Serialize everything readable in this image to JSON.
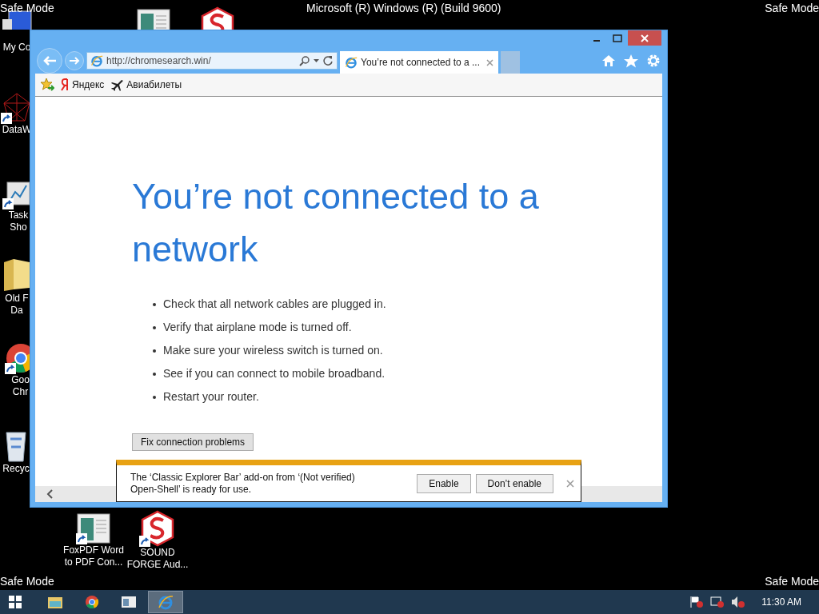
{
  "screen_labels": {
    "top_left": "Safe Mode",
    "top_center": "Microsoft (R) Windows (R) (Build 9600)",
    "top_right": "Safe Mode",
    "bottom_left": "Safe Mode",
    "bottom_right": "Safe Mode"
  },
  "desktop_icons": [
    {
      "kind": "computer",
      "lines": [
        "My Co"
      ]
    },
    {
      "kind": "web",
      "shortcut": true,
      "lines": [
        "DataW"
      ]
    },
    {
      "kind": "chart",
      "shortcut": true,
      "lines": [
        "Task",
        "Sho"
      ]
    },
    {
      "kind": "folder",
      "lines": [
        "Old F",
        "Da"
      ]
    },
    {
      "kind": "chrome",
      "shortcut": true,
      "lines": [
        "Goo",
        "Chr"
      ]
    },
    {
      "kind": "recycle",
      "lines": [
        "Recyc"
      ]
    },
    {
      "kind": "document"
    },
    {
      "kind": "sound"
    },
    {
      "kind": "document",
      "shortcut": true,
      "lines": [
        "FoxPDF Word",
        "to PDF Con..."
      ]
    },
    {
      "kind": "sound",
      "shortcut": true,
      "lines": [
        "SOUND",
        "FORGE Aud..."
      ]
    }
  ],
  "browser": {
    "address": "http://chromesearch.win/",
    "tabs": [
      {
        "title": "You’re not connected to a ...",
        "selected": true
      }
    ],
    "favorites": [
      {
        "kind": "yandex",
        "label": "Яндекс"
      },
      {
        "kind": "plane",
        "label": "Авиабилеты"
      }
    ],
    "page": {
      "heading": "You’re not connected to a network",
      "tips": [
        "Check that all network cables are plugged in.",
        "Verify that airplane mode is turned off.",
        "Make sure your wireless switch is turned on.",
        "See if you can connect to mobile broadband.",
        "Restart your router."
      ],
      "button": "Fix connection problems"
    },
    "notification": {
      "message": "The ‘Classic Explorer Bar’ add-on from ‘(Not verified) Open-Shell’ is ready for use.",
      "buttons": [
        "Enable",
        "Don’t enable"
      ]
    }
  },
  "taskbar": {
    "items": [
      {
        "kind": "explorer",
        "selected": false
      },
      {
        "kind": "chrome",
        "selected": false
      },
      {
        "kind": "app",
        "selected": false
      },
      {
        "kind": "ie",
        "selected": true
      }
    ],
    "clock": "11:30 AM"
  }
}
